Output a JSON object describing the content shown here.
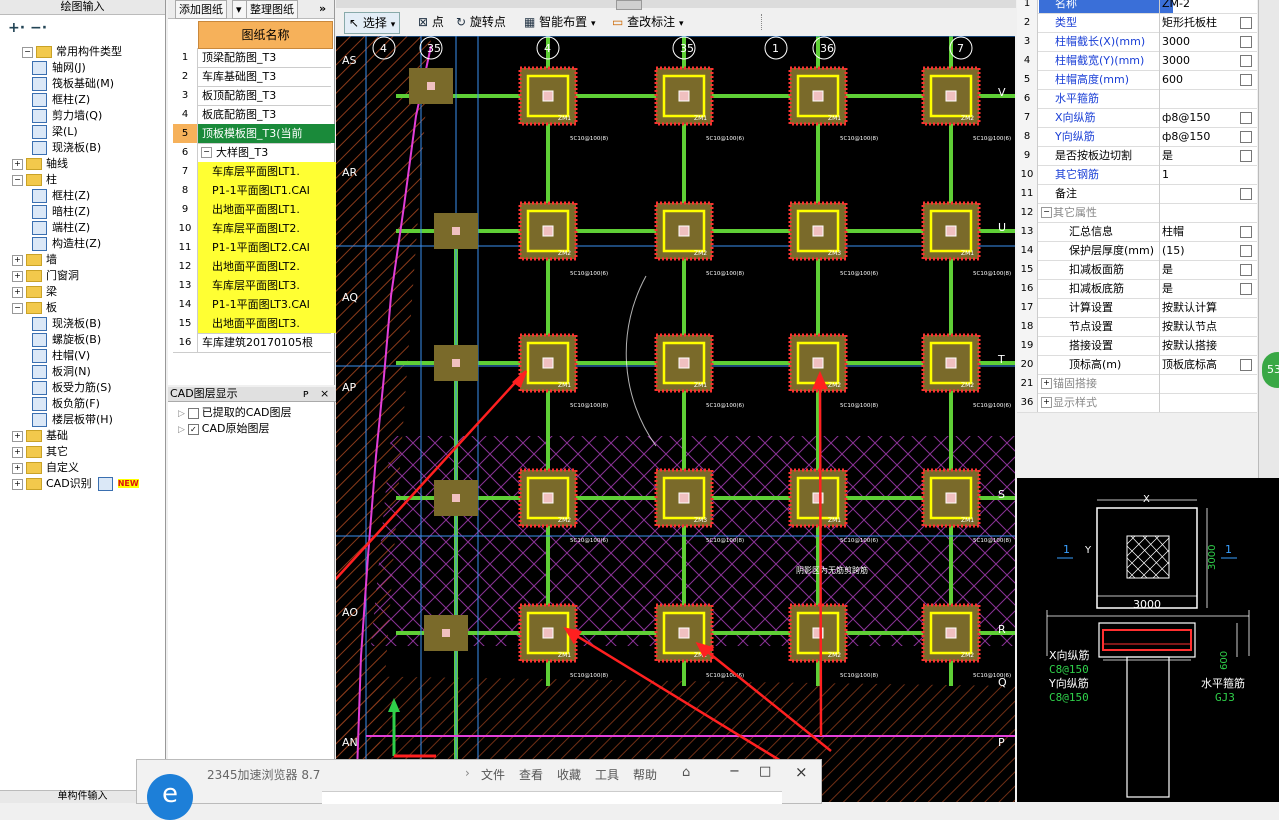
{
  "left_panel": {
    "title": "绘图输入",
    "footer": "单构件输入",
    "tree": [
      {
        "label": "常用构件类型",
        "kind": "folder",
        "indent": 1,
        "toggle": "-"
      },
      {
        "label": "轴网(J)",
        "kind": "item",
        "indent": 2
      },
      {
        "label": "筏板基础(M)",
        "kind": "item",
        "indent": 2
      },
      {
        "label": "框柱(Z)",
        "kind": "item",
        "indent": 2
      },
      {
        "label": "剪力墙(Q)",
        "kind": "item",
        "indent": 2
      },
      {
        "label": "梁(L)",
        "kind": "item",
        "indent": 2
      },
      {
        "label": "现浇板(B)",
        "kind": "item",
        "indent": 2
      },
      {
        "label": "轴线",
        "kind": "folder",
        "indent": 0,
        "toggle": "+"
      },
      {
        "label": "柱",
        "kind": "folder",
        "indent": 0,
        "toggle": "-"
      },
      {
        "label": "框柱(Z)",
        "kind": "item",
        "indent": 2
      },
      {
        "label": "暗柱(Z)",
        "kind": "item",
        "indent": 2
      },
      {
        "label": "端柱(Z)",
        "kind": "item",
        "indent": 2
      },
      {
        "label": "构造柱(Z)",
        "kind": "item",
        "indent": 2
      },
      {
        "label": "墙",
        "kind": "folder",
        "indent": 0,
        "toggle": "+"
      },
      {
        "label": "门窗洞",
        "kind": "folder",
        "indent": 0,
        "toggle": "+"
      },
      {
        "label": "梁",
        "kind": "folder",
        "indent": 0,
        "toggle": "+"
      },
      {
        "label": "板",
        "kind": "folder",
        "indent": 0,
        "toggle": "-"
      },
      {
        "label": "现浇板(B)",
        "kind": "item",
        "indent": 2
      },
      {
        "label": "螺旋板(B)",
        "kind": "item",
        "indent": 2
      },
      {
        "label": "柱帽(V)",
        "kind": "item",
        "indent": 2
      },
      {
        "label": "板洞(N)",
        "kind": "item",
        "indent": 2
      },
      {
        "label": "板受力筋(S)",
        "kind": "item",
        "indent": 2
      },
      {
        "label": "板负筋(F)",
        "kind": "item",
        "indent": 2
      },
      {
        "label": "楼层板带(H)",
        "kind": "item",
        "indent": 2
      },
      {
        "label": "基础",
        "kind": "folder",
        "indent": 0,
        "toggle": "+"
      },
      {
        "label": "其它",
        "kind": "folder",
        "indent": 0,
        "toggle": "+"
      },
      {
        "label": "自定义",
        "kind": "folder",
        "indent": 0,
        "toggle": "+"
      },
      {
        "label": "CAD识别",
        "kind": "folder",
        "indent": 0,
        "toggle": "+",
        "badge": "NEW"
      }
    ]
  },
  "drawing_list": {
    "add_button": "添加图纸",
    "organize_button": "整理图纸",
    "more": "»",
    "header": "图纸名称",
    "rows": [
      {
        "num": "1",
        "name": "顶梁配筋图_T3",
        "style": "normal"
      },
      {
        "num": "2",
        "name": "车库基础图_T3",
        "style": "normal"
      },
      {
        "num": "3",
        "name": "板顶配筋图_T3",
        "style": "normal"
      },
      {
        "num": "4",
        "name": "板底配筋图_T3",
        "style": "normal"
      },
      {
        "num": "5",
        "name": "顶板模板图_T3(当前",
        "style": "selected"
      },
      {
        "num": "6",
        "name": "大样图_T3",
        "style": "group"
      },
      {
        "num": "7",
        "name": "车库层平面图LT1.",
        "style": "yellow"
      },
      {
        "num": "8",
        "name": "P1-1平面图LT1.CAI",
        "style": "yellow"
      },
      {
        "num": "9",
        "name": "出地面平面图LT1.",
        "style": "yellow"
      },
      {
        "num": "10",
        "name": "车库层平面图LT2.",
        "style": "yellow"
      },
      {
        "num": "11",
        "name": "P1-1平面图LT2.CAI",
        "style": "yellow"
      },
      {
        "num": "12",
        "name": "出地面平面图LT2.",
        "style": "yellow"
      },
      {
        "num": "13",
        "name": "车库层平面图LT3.",
        "style": "yellow"
      },
      {
        "num": "14",
        "name": "P1-1平面图LT3.CAI",
        "style": "yellow"
      },
      {
        "num": "15",
        "name": "出地面平面图LT3.",
        "style": "yellow"
      },
      {
        "num": "16",
        "name": "车库建筑20170105根",
        "style": "normal"
      }
    ]
  },
  "layer_panel": {
    "title": "CAD图层显示",
    "pin": "ᴘ",
    "close": "×",
    "items": [
      {
        "label": "已提取的CAD图层",
        "checked": false
      },
      {
        "label": "CAD原始图层",
        "checked": true
      }
    ]
  },
  "main_toolbar": {
    "select": "选择",
    "point": "点",
    "rotate_point": "旋转点",
    "smart_layout": "智能布置",
    "check_annotation": "查改标注"
  },
  "canvas": {
    "axis_labels_top": [
      "4",
      "35",
      "4",
      "35",
      "1",
      "36",
      "7"
    ],
    "axis_labels_left": [
      "AS",
      "AR",
      "AQ",
      "AP",
      "AO",
      "AN"
    ],
    "axis_labels_right": [
      "V",
      "U",
      "T",
      "S",
      "R",
      "Q",
      "P"
    ],
    "column_tags": [
      "ZM1",
      "ZM1",
      "ZM1",
      "ZM2",
      "ZM2",
      "ZM2",
      "ZM3"
    ],
    "beam_labels": [
      "5C10@100(8)",
      "5C10@100(6)"
    ],
    "annotation_text": "阴影区为无筋剪跨筋",
    "arrow_color": "#ff2020"
  },
  "properties": {
    "rows": [
      {
        "num": "1",
        "name": "名称",
        "value": "ZM-2",
        "color": "#1a3fd6",
        "checkbox": false,
        "selected": true
      },
      {
        "num": "2",
        "name": "类型",
        "value": "矩形托板柱",
        "color": "#1a3fd6",
        "checkbox": true
      },
      {
        "num": "3",
        "name": "柱帽截长(X)(mm)",
        "value": "3000",
        "color": "#1a3fd6",
        "checkbox": true
      },
      {
        "num": "4",
        "name": "柱帽截宽(Y)(mm)",
        "value": "3000",
        "color": "#1a3fd6",
        "checkbox": true
      },
      {
        "num": "5",
        "name": "柱帽高度(mm)",
        "value": "600",
        "color": "#1a3fd6",
        "checkbox": true
      },
      {
        "num": "6",
        "name": "水平箍筋",
        "value": "",
        "color": "#1a3fd6",
        "checkbox": false
      },
      {
        "num": "7",
        "name": "X向纵筋",
        "value": "ф8@150",
        "color": "#1a3fd6",
        "checkbox": true
      },
      {
        "num": "8",
        "name": "Y向纵筋",
        "value": "ф8@150",
        "color": "#1a3fd6",
        "checkbox": true
      },
      {
        "num": "9",
        "name": "是否按板边切割",
        "value": "是",
        "color": "#000000",
        "checkbox": true
      },
      {
        "num": "10",
        "name": "其它钢筋",
        "value": "1",
        "color": "#1a3fd6",
        "checkbox": false
      },
      {
        "num": "11",
        "name": "备注",
        "value": "",
        "color": "#000000",
        "checkbox": true
      },
      {
        "num": "12",
        "name": "其它属性",
        "value": "",
        "color": "#888888",
        "checkbox": false,
        "group": "-"
      },
      {
        "num": "13",
        "name": "汇总信息",
        "value": "柱帽",
        "color": "#000000",
        "checkbox": true,
        "indent": true
      },
      {
        "num": "14",
        "name": "保护层厚度(mm)",
        "value": "(15)",
        "color": "#000000",
        "checkbox": true,
        "indent": true
      },
      {
        "num": "15",
        "name": "扣减板面筋",
        "value": "是",
        "color": "#000000",
        "checkbox": true,
        "indent": true
      },
      {
        "num": "16",
        "name": "扣减板底筋",
        "value": "是",
        "color": "#000000",
        "checkbox": true,
        "indent": true
      },
      {
        "num": "17",
        "name": "计算设置",
        "value": "按默认计算",
        "color": "#000000",
        "checkbox": false,
        "indent": true
      },
      {
        "num": "18",
        "name": "节点设置",
        "value": "按默认节点",
        "color": "#000000",
        "checkbox": false,
        "indent": true
      },
      {
        "num": "19",
        "name": "搭接设置",
        "value": "按默认搭接",
        "color": "#000000",
        "checkbox": false,
        "indent": true
      },
      {
        "num": "20",
        "name": "顶标高(m)",
        "value": "顶板底标高",
        "color": "#000000",
        "checkbox": true,
        "indent": true
      },
      {
        "num": "21",
        "name": "锚固搭接",
        "value": "",
        "color": "#888888",
        "checkbox": false,
        "group": "+"
      },
      {
        "num": "36",
        "name": "显示样式",
        "value": "",
        "color": "#888888",
        "checkbox": false,
        "group": "+"
      }
    ],
    "badge": "53"
  },
  "preview": {
    "x_label": "X",
    "y_label": "Y",
    "dim_width": "3000",
    "dim_height": "3000",
    "section_mark": "1",
    "height_dim": "600",
    "x_rebar_label": "X向纵筋",
    "x_rebar_value": "C8@150",
    "y_rebar_label": "Y向纵筋",
    "y_rebar_value": "C8@150",
    "stirrup_label": "水平箍筋",
    "stirrup_value": "GJ3"
  },
  "browser": {
    "title": "2345加速浏览器 8.7",
    "menu": [
      "文件",
      "查看",
      "收藏",
      "工具",
      "帮助"
    ],
    "min": "−",
    "max": "□",
    "close": "×",
    "logo": "e"
  }
}
